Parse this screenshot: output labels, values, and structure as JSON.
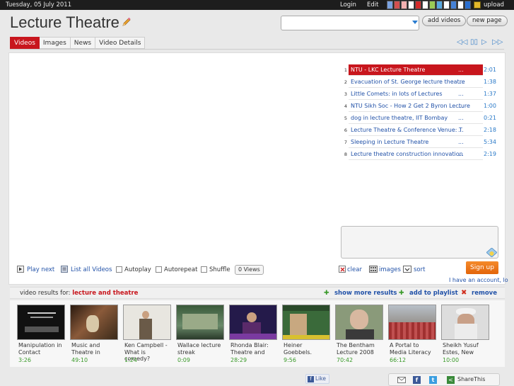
{
  "topbar": {
    "date": "Tuesday, 05 July 2011",
    "login": "Login",
    "edit": "Edit",
    "upload": "upload",
    "theme_colors": [
      "#7aa2e0",
      "#d25050",
      "#f2b0b0",
      "#ffffff",
      "#d32a2a",
      "#ffffff",
      "#9acb55",
      "#57a8e0",
      "#ffffff",
      "#4682d6",
      "#ffffff",
      "#2a6fd0"
    ]
  },
  "header": {
    "title": "Lecture Theatre",
    "add_videos": "add videos",
    "new_page": "new page"
  },
  "tabs": [
    "Videos",
    "Images",
    "News",
    "Video Details"
  ],
  "playlist": [
    {
      "num": "1",
      "title": "NTU - LKC Lecture Theatre",
      "time": "2:01",
      "active": true
    },
    {
      "num": "2",
      "title": "Evacuation of St. George lecture theatre",
      "time": "1:38",
      "active": false
    },
    {
      "num": "3",
      "title": "Little Comets: in lots of Lectures",
      "time": "1:37",
      "active": false
    },
    {
      "num": "4",
      "title": "NTU Sikh Soc - How 2 Get 2 Byron Lecture",
      "time": "1:00",
      "active": false
    },
    {
      "num": "5",
      "title": "dog in lecture theatre, IIT Bombay",
      "time": "0:21",
      "active": false
    },
    {
      "num": "6",
      "title": "Lecture Theatre & Conference Venue: T",
      "time": "2:18",
      "active": false
    },
    {
      "num": "7",
      "title": "Sleeping in Lecture Theatre",
      "time": "5:34",
      "active": false
    },
    {
      "num": "8",
      "title": "Lecture theatre construction innovation",
      "time": "2:19",
      "active": false
    }
  ],
  "controls": {
    "play_next": "Play next",
    "list_all": "List all Videos",
    "autoplay": "Autoplay",
    "autorepeat": "Autorepeat",
    "shuffle": "Shuffle",
    "views": "0 Views",
    "clear": "clear",
    "images": "images",
    "sort": "sort",
    "sign_up": "Sign up",
    "account": "I have an account, lo"
  },
  "results_bar": {
    "label": "video results for:",
    "query": "lecture and theatre",
    "show_more": "show more results",
    "add_to_playlist": "add to playlist",
    "remove": "remove"
  },
  "results": [
    {
      "title": "Manipulation in Contact",
      "duration": "3:26"
    },
    {
      "title": "Music and Theatre in",
      "duration": "49:10"
    },
    {
      "title": "Ken Campbell - What is comedy?",
      "duration": "1:24"
    },
    {
      "title": "Wallace lecture streak",
      "duration": "0:09"
    },
    {
      "title": "Rhonda Blair: Theatre and",
      "duration": "28:29"
    },
    {
      "title": "Heiner Goebbels.",
      "duration": "9:56"
    },
    {
      "title": "The Bentham Lecture 2008",
      "duration": "70:42"
    },
    {
      "title": "A Portal to Media Literacy",
      "duration": "66:12"
    },
    {
      "title": "Sheikh Yusuf Estes, New",
      "duration": "10:00"
    }
  ],
  "footer": {
    "like": "Like",
    "share": "ShareThis"
  }
}
